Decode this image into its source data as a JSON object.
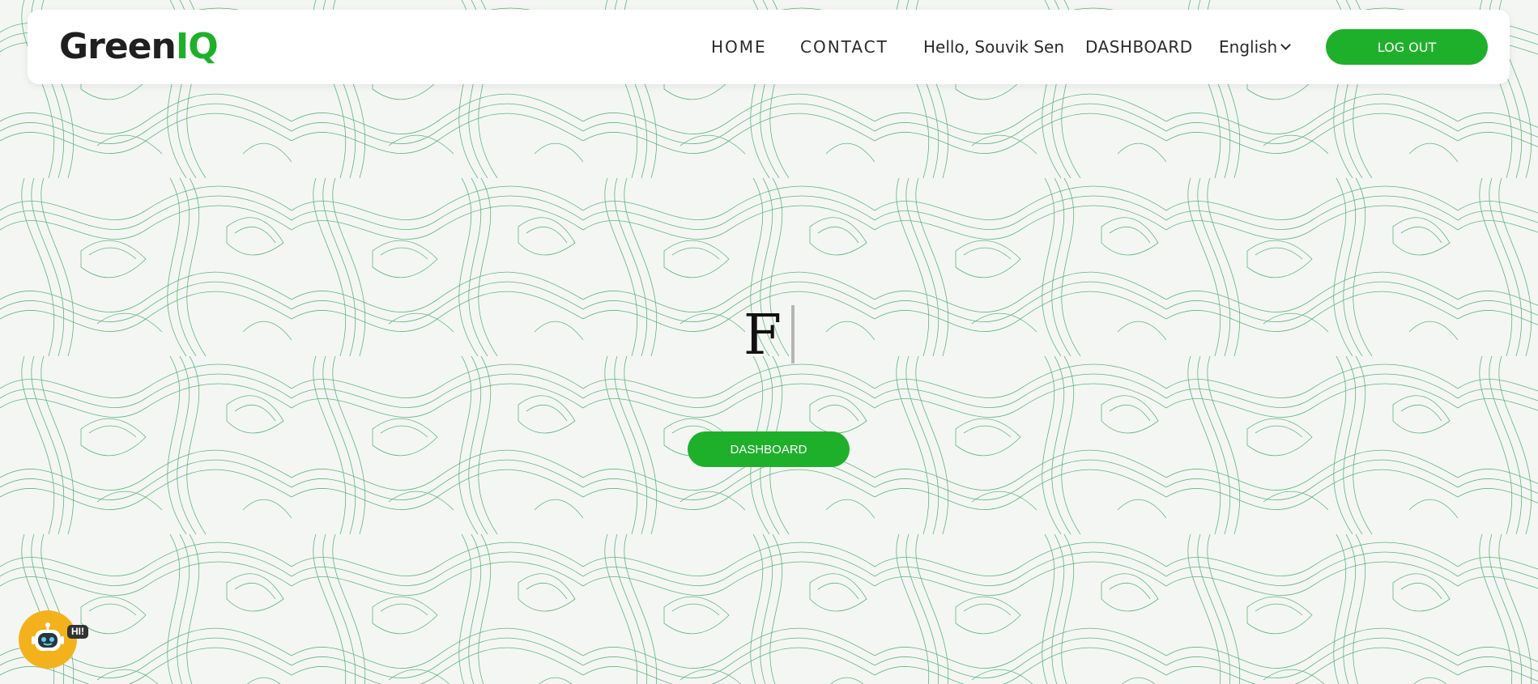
{
  "brand": {
    "name_main": "Green",
    "name_accent": "IQ",
    "accent_color": "#1fb02b"
  },
  "nav": {
    "home": "HOME",
    "contact": "CONTACT",
    "greeting": "Hello, Souvik Sen",
    "dashboard": "DASHBOARD",
    "language": "English",
    "logout": "LOG OUT"
  },
  "hero": {
    "typed_text": "F",
    "cta_label": "DASHBOARD"
  },
  "chatbot": {
    "badge": "HI!",
    "icon": "robot-icon",
    "color": "#f3b21c"
  }
}
